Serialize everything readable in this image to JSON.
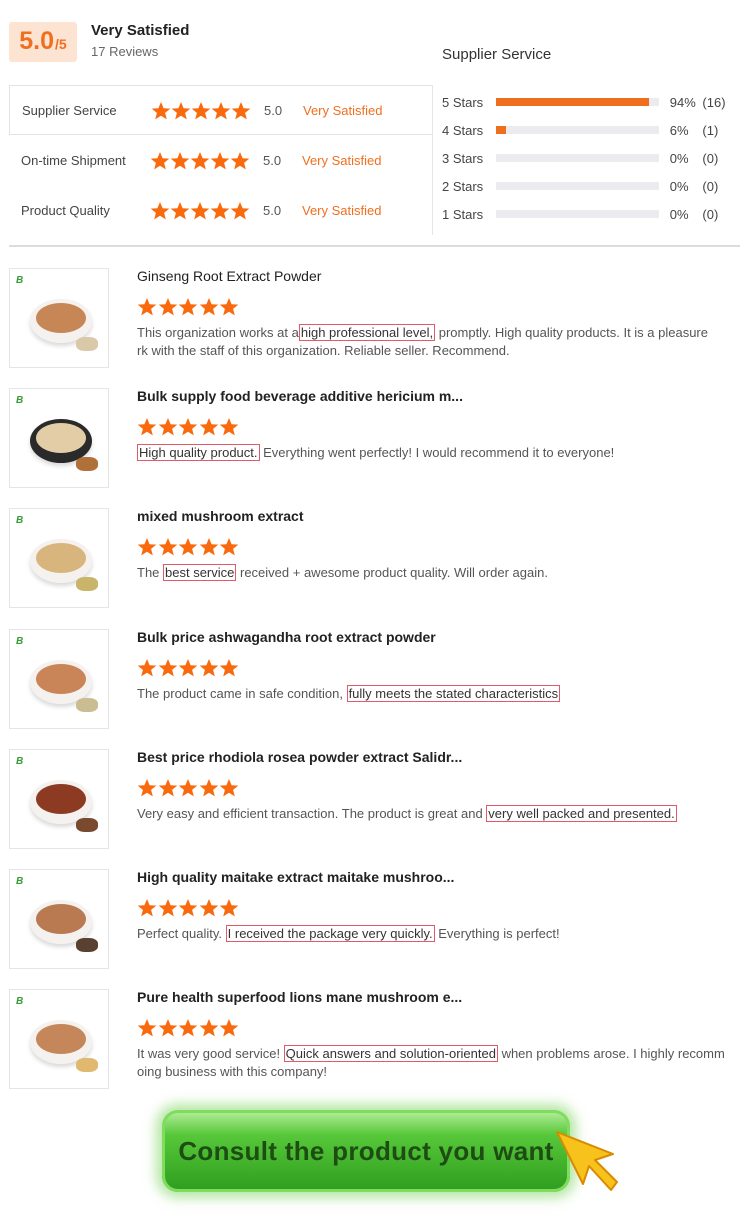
{
  "summary": {
    "score": "5.0",
    "score_suffix": "/5",
    "title": "Very Satisfied",
    "review_count": "17 Reviews"
  },
  "ratings": [
    {
      "label": "Supplier Service",
      "value": "5.0",
      "status": "Very Satisfied",
      "stars": 5
    },
    {
      "label": "On-time Shipment",
      "value": "5.0",
      "status": "Very Satisfied",
      "stars": 5
    },
    {
      "label": "Product Quality",
      "value": "5.0",
      "status": "Very Satisfied",
      "stars": 5
    }
  ],
  "distribution": {
    "title": "Supplier Service",
    "rows": [
      {
        "label": "5 Stars",
        "fraction": 0.94,
        "percent": "94%",
        "count": "(16)"
      },
      {
        "label": "4 Stars",
        "fraction": 0.06,
        "percent": "6%",
        "count": "(1)"
      },
      {
        "label": "3 Stars",
        "fraction": 0,
        "percent": "0%",
        "count": "(0)"
      },
      {
        "label": "2 Stars",
        "fraction": 0,
        "percent": "0%",
        "count": "(0)"
      },
      {
        "label": "1 Stars",
        "fraction": 0,
        "percent": "0%",
        "count": "(0)"
      }
    ]
  },
  "reviews": [
    {
      "title": "Ginseng Root Extract Powder",
      "stars": 5,
      "before": "This organization works at a",
      "highlight": "high professional level,",
      "after": " promptly.  High quality products.  It is a pleasure",
      "line2": "rk with the staff of this organization.  Reliable seller.  Recommend."
    },
    {
      "title": "Bulk supply food beverage additive hericium m...",
      "stars": 5,
      "before": "",
      "highlight": "High quality product.",
      "after": " Everything went perfectly!  I would recommend it to everyone!",
      "line2": ""
    },
    {
      "title": "mixed mushroom extract",
      "stars": 5,
      "before": "The ",
      "highlight": "best service",
      "after": " received + awesome product quality. Will order again.",
      "line2": ""
    },
    {
      "title": "Bulk price ashwagandha root extract powder",
      "stars": 5,
      "before": "The product came in safe condition, ",
      "highlight": "fully meets the stated characteristics",
      "after": "",
      "line2": ""
    },
    {
      "title": "Best price rhodiola rosea powder extract Salidr...",
      "stars": 5,
      "before": "Very easy and efficient transaction.  The product is great and ",
      "highlight": "very well packed and presented.",
      "after": "",
      "line2": ""
    },
    {
      "title": "High quality maitake extract maitake mushroo...",
      "stars": 5,
      "before": "Perfect quality. ",
      "highlight": "I received the package very quickly.",
      "after": " Everything is perfect!",
      "line2": ""
    },
    {
      "title": "Pure health superfood lions mane mushroom e...",
      "stars": 5,
      "before": "It was very good service! ",
      "highlight": "Quick answers and solution-oriented",
      "after": " when problems arose. I highly recomm",
      "line2": "oing business with this company!"
    }
  ],
  "cta": {
    "label": "Consult the product you want"
  },
  "colors": {
    "accent": "#f06f1f",
    "star": "#f96a0e",
    "highlight_border": "#e05a6a",
    "cta_green": "#2e9c1e"
  }
}
